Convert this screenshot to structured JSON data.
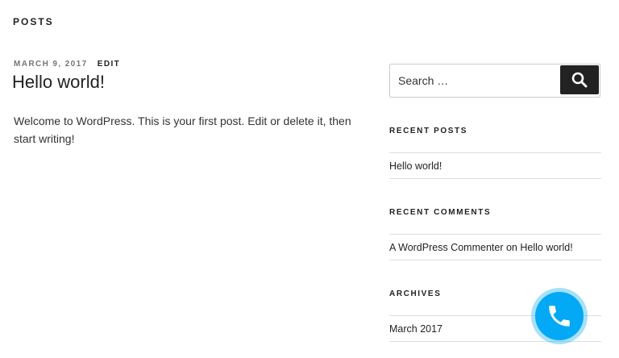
{
  "page": {
    "heading": "POSTS"
  },
  "post": {
    "date": "MARCH 9, 2017",
    "edit_label": "EDIT",
    "title": "Hello world!",
    "content": "Welcome to WordPress. This is your first post. Edit or delete it, then start writing!"
  },
  "sidebar": {
    "search": {
      "placeholder": "Search …",
      "button_icon": "search-icon"
    },
    "recent_posts": {
      "title": "RECENT POSTS",
      "items": [
        "Hello world!"
      ]
    },
    "recent_comments": {
      "title": "RECENT COMMENTS",
      "items": [
        {
          "author": "A WordPress Commenter",
          "on": "on",
          "post": "Hello world!"
        }
      ]
    },
    "archives": {
      "title": "ARCHIVES",
      "items": [
        "March 2017"
      ]
    }
  },
  "call_button": {
    "icon": "phone-icon",
    "color": "#03a9f4"
  }
}
